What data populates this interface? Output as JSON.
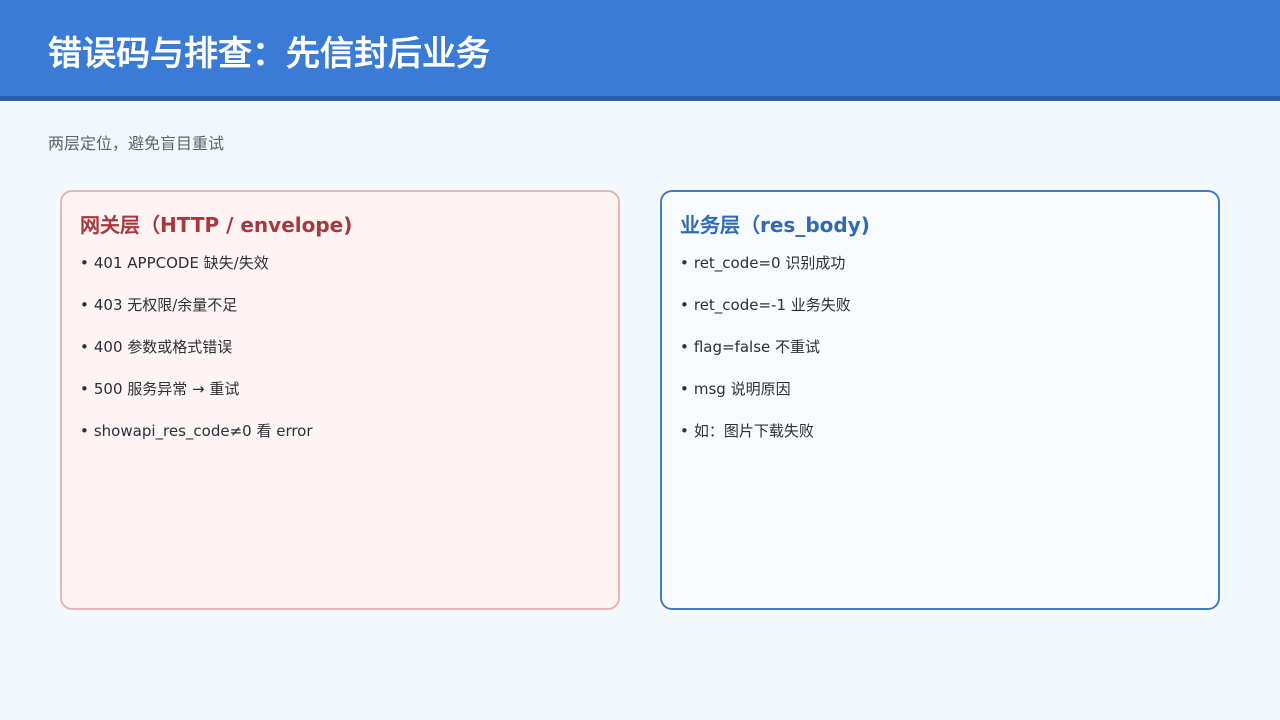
{
  "header": {
    "title": "错误码与排查：先信封后业务"
  },
  "subtitle": "两层定位，避免盲目重试",
  "bullet_symbol": "•",
  "cards": [
    {
      "title": "网关层（HTTP / envelope)",
      "items": [
        "401 APPCODE 缺失/失效",
        "403 无权限/余量不足",
        "400 参数或格式错误",
        "500 服务异常 → 重试",
        "showapi_res_code≠0 看 error"
      ],
      "border_color": "#e6b3b6",
      "background_color": "#fff4f4",
      "title_color": "#a7383d"
    },
    {
      "title": "业务层（res_body)",
      "items": [
        "ret_code=0 识别成功",
        "ret_code=-1 业务失败",
        "flag=false 不重试",
        "msg 说明原因",
        "如：图片下载失败"
      ],
      "border_color": "#3f7ec4",
      "background_color": "#f8fbfe",
      "title_color": "#2f6bb4"
    }
  ],
  "colors": {
    "header_bg": "#3a7bd5",
    "header_border": "#2a5fa8",
    "page_bg": "#f3f8fc"
  }
}
